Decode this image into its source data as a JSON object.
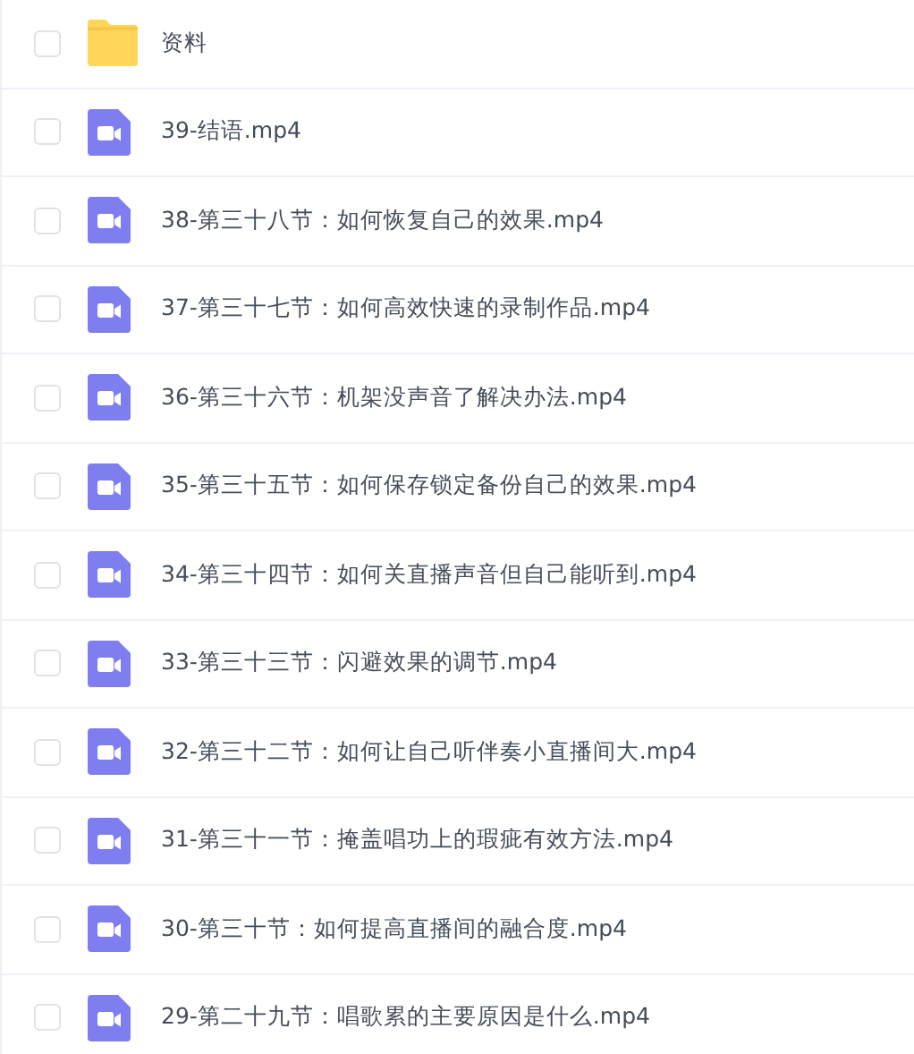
{
  "files": [
    {
      "kind": "folder",
      "name": "资料",
      "checked": false
    },
    {
      "kind": "video",
      "name": "39-结语.mp4",
      "checked": false
    },
    {
      "kind": "video",
      "name": "38-第三十八节：如何恢复自己的效果.mp4",
      "checked": false
    },
    {
      "kind": "video",
      "name": "37-第三十七节：如何高效快速的录制作品.mp4",
      "checked": false
    },
    {
      "kind": "video",
      "name": "36-第三十六节：机架没声音了解决办法.mp4",
      "checked": false
    },
    {
      "kind": "video",
      "name": "35-第三十五节：如何保存锁定备份自己的效果.mp4",
      "checked": false
    },
    {
      "kind": "video",
      "name": "34-第三十四节：如何关直播声音但自己能听到.mp4",
      "checked": false
    },
    {
      "kind": "video",
      "name": "33-第三十三节：闪避效果的调节.mp4",
      "checked": false
    },
    {
      "kind": "video",
      "name": "32-第三十二节：如何让自己听伴奏小直播间大.mp4",
      "checked": false
    },
    {
      "kind": "video",
      "name": "31-第三十一节：掩盖唱功上的瑕疵有效方法.mp4",
      "checked": false
    },
    {
      "kind": "video",
      "name": "30-第三十节：如何提高直播间的融合度.mp4",
      "checked": false
    },
    {
      "kind": "video",
      "name": "29-第二十九节：唱歌累的主要原因是什么.mp4",
      "checked": false
    }
  ]
}
